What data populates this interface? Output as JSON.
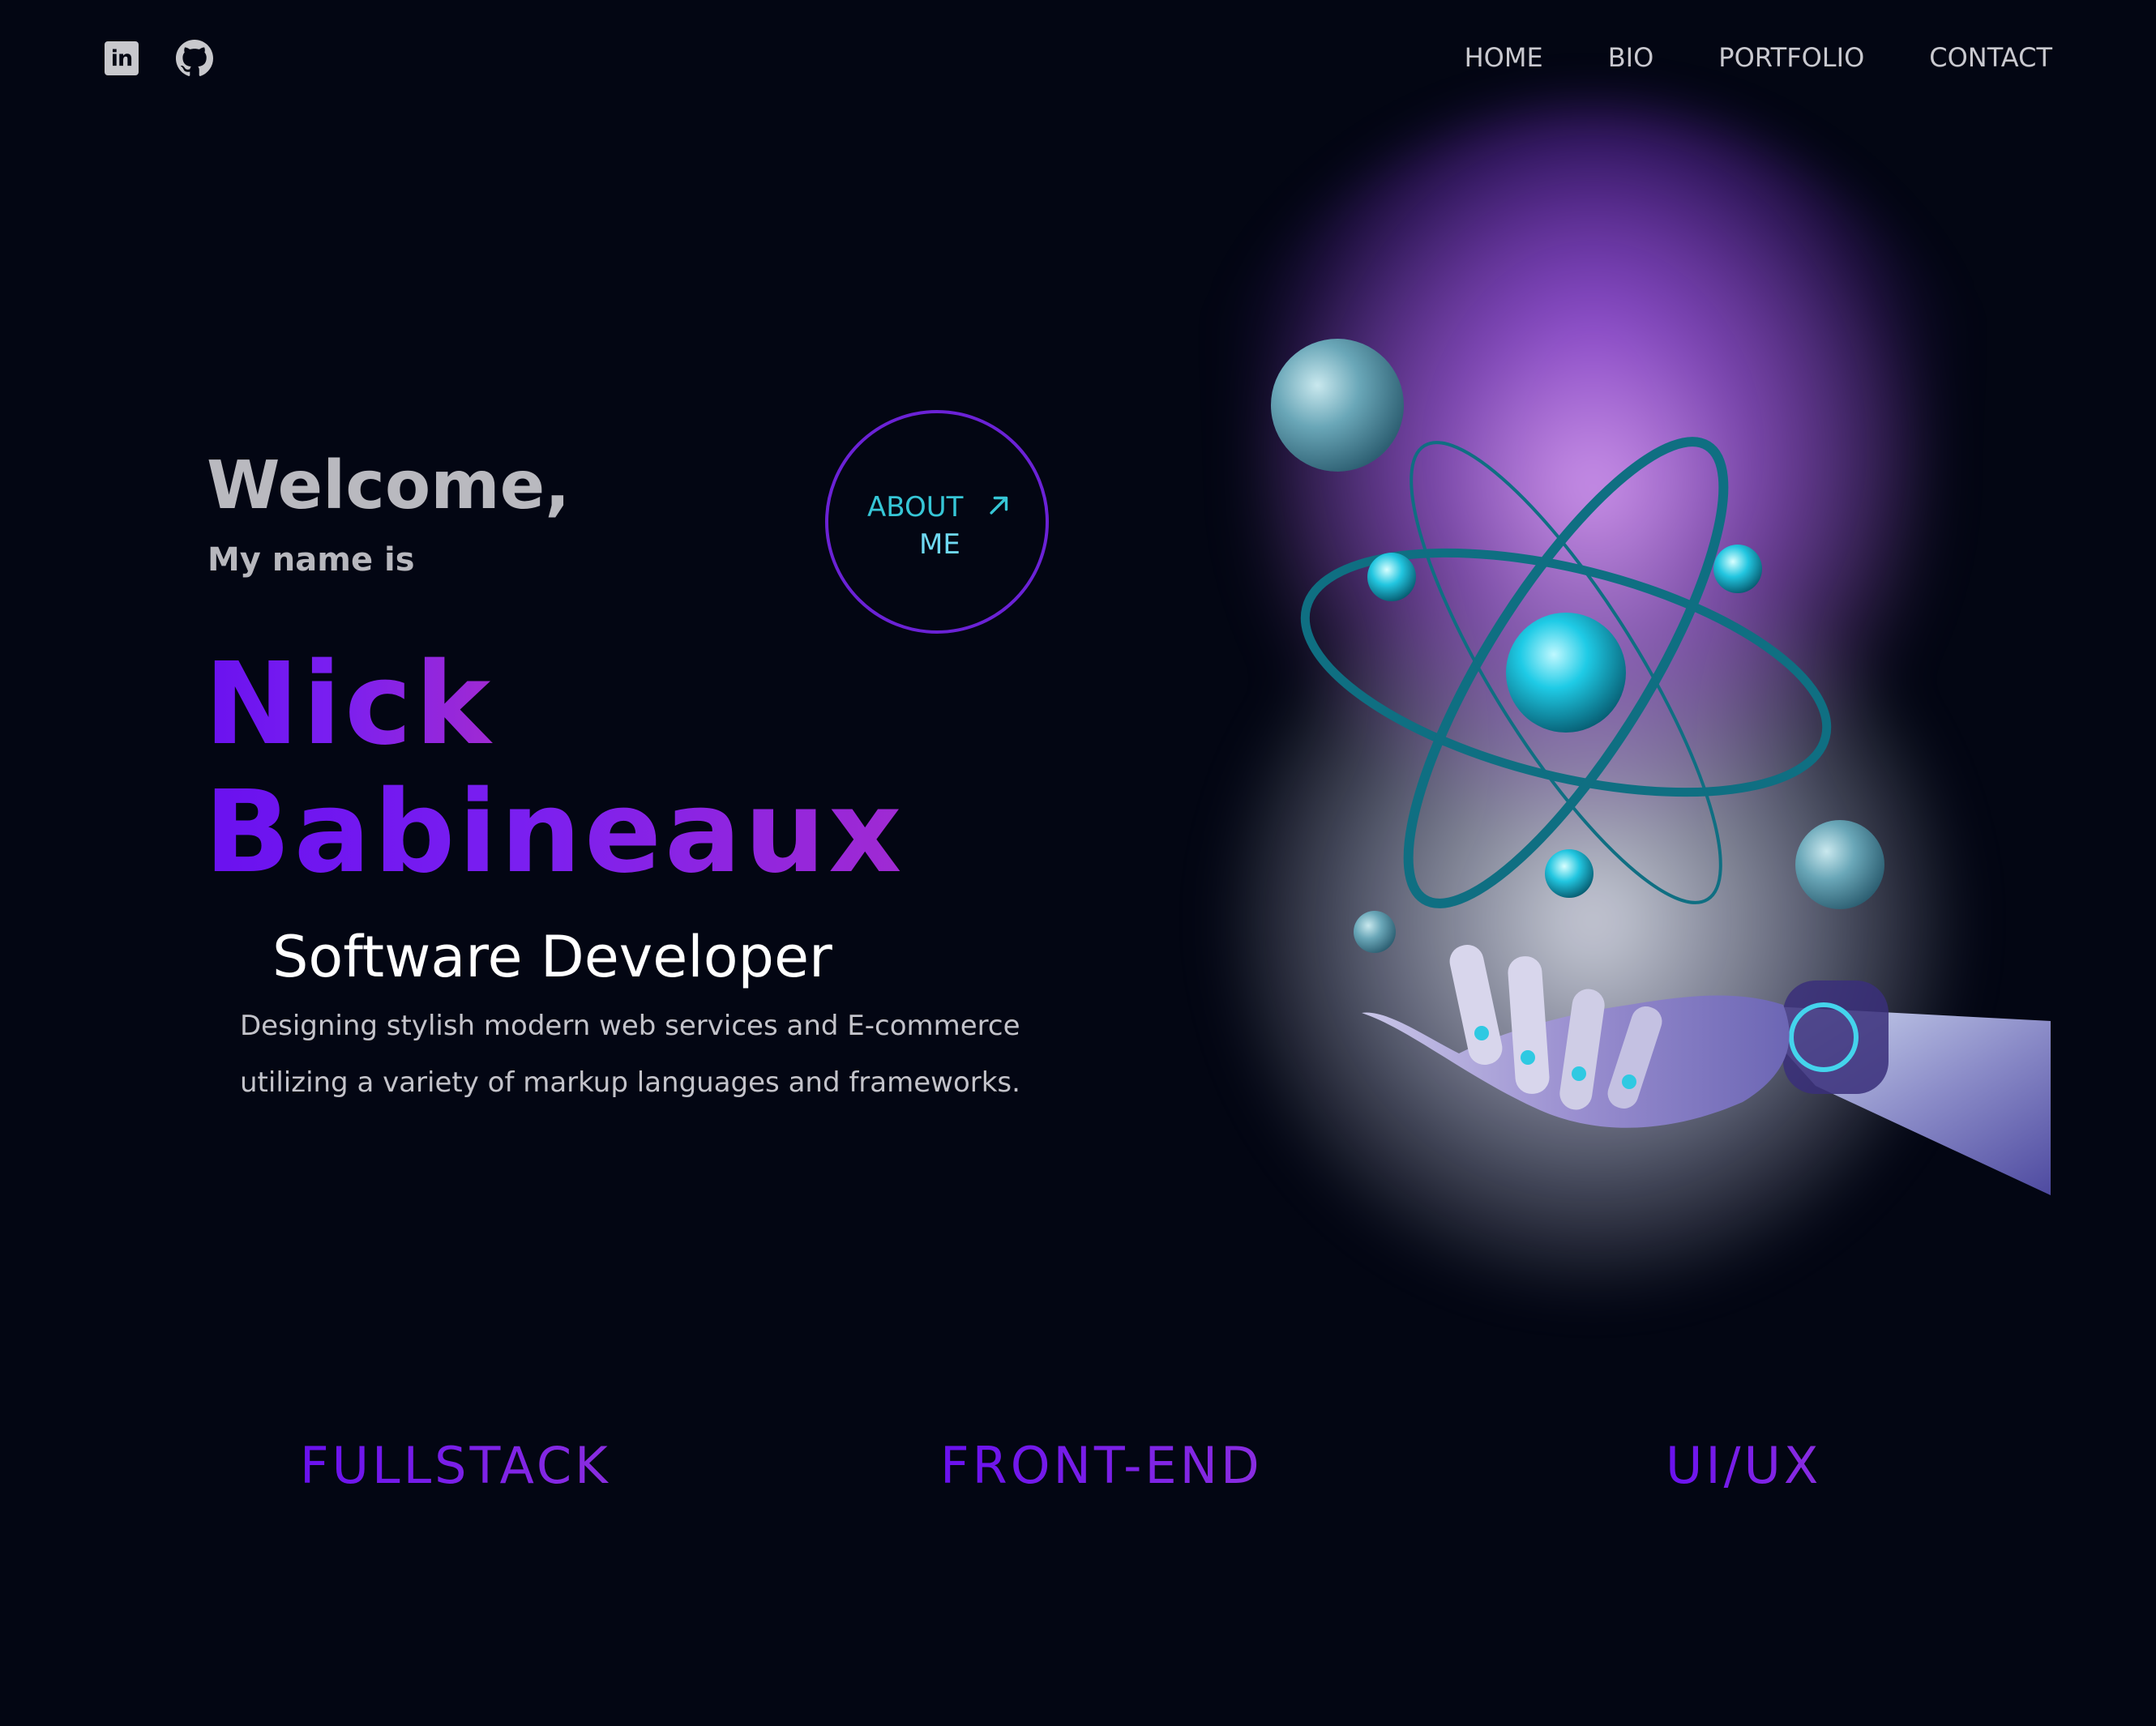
{
  "social": {
    "linkedin_label": "in"
  },
  "nav": {
    "items": [
      "HOME",
      "BIO",
      "PORTFOLIO",
      "CONTACT"
    ]
  },
  "hero": {
    "welcome": "Welcome,",
    "my_name_is": "My name is",
    "first_name": "Nick",
    "last_name": "Babineaux",
    "role": "Software Developer",
    "description_line1": "Designing stylish modern web services and E-commerce",
    "description_line2": "utilizing a variety of markup languages and frameworks."
  },
  "about_button": {
    "line1": "ABOUT",
    "line2": "ME"
  },
  "skills": [
    "FULLSTACK",
    "FRONT-END",
    "UI/UX"
  ],
  "colors": {
    "background": "#030613",
    "accent_purple": "#6a11ef",
    "accent_cyan": "#36c6d6"
  }
}
